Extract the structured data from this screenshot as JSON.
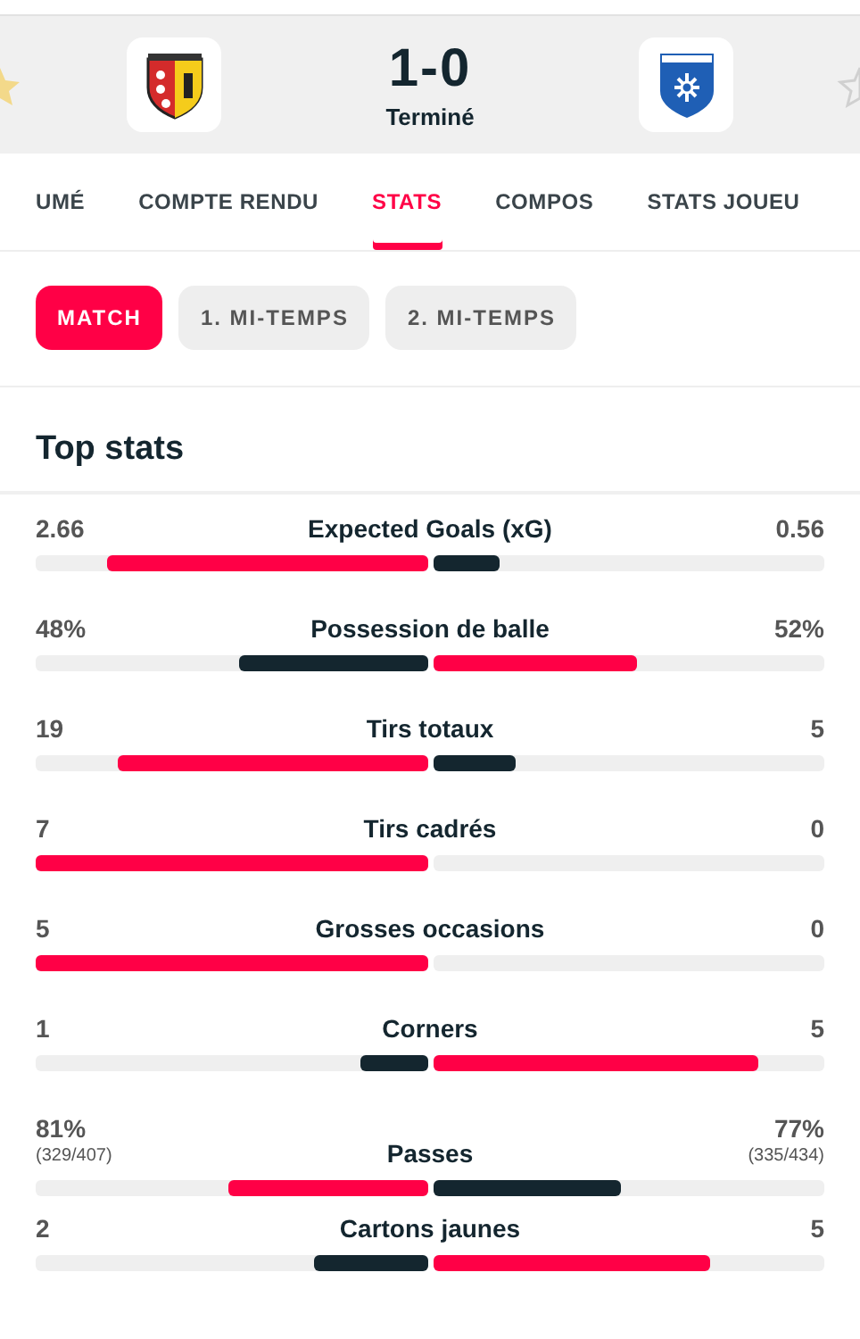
{
  "match": {
    "home_favorite": true,
    "away_favorite": false,
    "score": "1-0",
    "status": "Terminé"
  },
  "tabs": [
    {
      "label": "UMÉ",
      "selected": false
    },
    {
      "label": "COMPTE RENDU",
      "selected": false
    },
    {
      "label": "STATS",
      "selected": true
    },
    {
      "label": "COMPOS",
      "selected": false
    },
    {
      "label": "STATS JOUEU",
      "selected": false
    }
  ],
  "periods": [
    {
      "label": "MATCH",
      "selected": true
    },
    {
      "label": "1. MI-TEMPS",
      "selected": false
    },
    {
      "label": "2. MI-TEMPS",
      "selected": false
    }
  ],
  "section_title": "Top stats",
  "stats": [
    {
      "name": "Expected Goals (xG)",
      "home": {
        "value": "2.66",
        "level": 0.82,
        "highlighted": true
      },
      "away": {
        "value": "0.56",
        "level": 0.17,
        "highlighted": false
      }
    },
    {
      "name": "Possession de balle",
      "home": {
        "value": "48%",
        "level": 0.48,
        "highlighted": false
      },
      "away": {
        "value": "52%",
        "level": 0.52,
        "highlighted": true
      }
    },
    {
      "name": "Tirs totaux",
      "home": {
        "value": "19",
        "level": 0.79,
        "highlighted": true
      },
      "away": {
        "value": "5",
        "level": 0.21,
        "highlighted": false
      }
    },
    {
      "name": "Tirs cadrés",
      "home": {
        "value": "7",
        "level": 1,
        "highlighted": true
      },
      "away": {
        "value": "0"
      }
    },
    {
      "name": "Grosses occasions",
      "home": {
        "value": "5",
        "level": 1,
        "highlighted": true
      },
      "away": {
        "value": "0"
      }
    },
    {
      "name": "Corners",
      "home": {
        "value": "1",
        "level": 0.17,
        "highlighted": false
      },
      "away": {
        "value": "5",
        "level": 0.83,
        "highlighted": true
      }
    },
    {
      "name": "Passes",
      "home": {
        "value": "81%",
        "detail": "(329/407)",
        "level": 0.51,
        "highlighted": true
      },
      "away": {
        "value": "77%",
        "detail": "(335/434)",
        "level": 0.48,
        "highlighted": false
      }
    },
    {
      "name": "Cartons jaunes",
      "home": {
        "value": "2",
        "level": 0.29,
        "highlighted": false
      },
      "away": {
        "value": "5",
        "level": 0.71,
        "highlighted": true
      }
    }
  ]
}
